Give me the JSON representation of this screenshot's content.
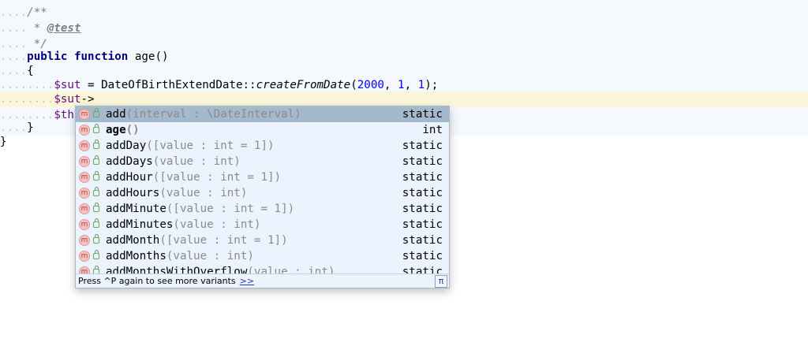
{
  "code": {
    "doc_open": "/**",
    "doc_star": " * ",
    "doc_tag": "@test",
    "doc_close": " */",
    "kw_public": "public",
    "kw_function": "function",
    "fn_name": " age()",
    "brace_open": "{",
    "var_sut": "$sut",
    "assign": " = DateOfBirthExtendDate::",
    "static_call": "createFromDate",
    "paren_open": "(",
    "arg1": "2000",
    "comma1": ", ",
    "arg2": "1",
    "comma2": ", ",
    "arg3": "1",
    "paren_close": ");",
    "arrow": "->",
    "var_this_partial": "$thi",
    "brace_close_inner": "}",
    "brace_close_outer": "}"
  },
  "completion": {
    "items": [
      {
        "name": "add",
        "params": "(interval : \\DateInterval)",
        "type": "static",
        "icon": "m"
      },
      {
        "name": "age",
        "params": "()",
        "type": "int",
        "icon": "m"
      },
      {
        "name": "addDay",
        "params": "([value : int = 1])",
        "type": "static",
        "icon": "m"
      },
      {
        "name": "addDays",
        "params": "(value : int)",
        "type": "static",
        "icon": "m"
      },
      {
        "name": "addHour",
        "params": "([value : int = 1])",
        "type": "static",
        "icon": "m"
      },
      {
        "name": "addHours",
        "params": "(value : int)",
        "type": "static",
        "icon": "m"
      },
      {
        "name": "addMinute",
        "params": "([value : int = 1])",
        "type": "static",
        "icon": "m"
      },
      {
        "name": "addMinutes",
        "params": "(value : int)",
        "type": "static",
        "icon": "m"
      },
      {
        "name": "addMonth",
        "params": "([value : int = 1])",
        "type": "static",
        "icon": "m"
      },
      {
        "name": "addMonths",
        "params": "(value : int)",
        "type": "static",
        "icon": "m"
      },
      {
        "name": "addMonthsWithOverflow",
        "params": "(value : int)",
        "type": "static",
        "icon": "m"
      }
    ],
    "footer_hint": "Press ^P again to see more variants",
    "footer_more": ">>",
    "pi_glyph": "π"
  }
}
